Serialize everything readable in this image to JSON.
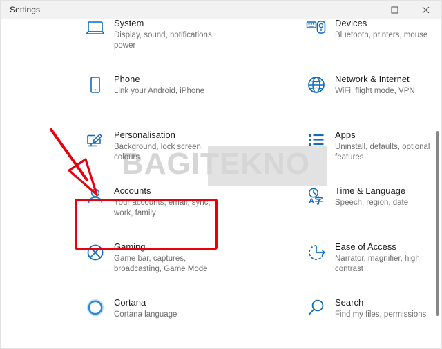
{
  "window": {
    "title": "Settings",
    "controls": [
      {
        "name": "minimize",
        "label": "–"
      },
      {
        "name": "maximize",
        "label": "□"
      },
      {
        "name": "close",
        "label": "×"
      }
    ]
  },
  "watermark": {
    "text": "BAGITEKNO"
  },
  "annotations": {
    "highlight_color": "#e8000d",
    "arrow_color": "#e8000d",
    "highlighted_tile": "Accounts"
  },
  "settings": {
    "tiles": [
      {
        "id": "system",
        "icon": "monitor-icon",
        "title": "System",
        "subtitle": "Display, sound, notifications, power"
      },
      {
        "id": "devices",
        "icon": "keyboard-mouse-icon",
        "title": "Devices",
        "subtitle": "Bluetooth, printers, mouse"
      },
      {
        "id": "phone",
        "icon": "phone-icon",
        "title": "Phone",
        "subtitle": "Link your Android, iPhone"
      },
      {
        "id": "network-internet",
        "icon": "globe-icon",
        "title": "Network & Internet",
        "subtitle": "WiFi, flight mode, VPN"
      },
      {
        "id": "personalisation",
        "icon": "brush-monitor-icon",
        "title": "Personalisation",
        "subtitle": "Background, lock screen, colours"
      },
      {
        "id": "apps",
        "icon": "list-icon",
        "title": "Apps",
        "subtitle": "Uninstall, defaults, optional features"
      },
      {
        "id": "accounts",
        "icon": "person-icon",
        "title": "Accounts",
        "subtitle": "Your accounts, email, sync, work, family"
      },
      {
        "id": "time-language",
        "icon": "clock-language-icon",
        "title": "Time & Language",
        "subtitle": "Speech, region, date"
      },
      {
        "id": "gaming",
        "icon": "xbox-icon",
        "title": "Gaming",
        "subtitle": "Game bar, captures, broadcasting, Game Mode"
      },
      {
        "id": "ease-of-access",
        "icon": "accessibility-clock-icon",
        "title": "Ease of Access",
        "subtitle": "Narrator, magnifier, high contrast"
      },
      {
        "id": "cortana",
        "icon": "cortana-ring-icon",
        "title": "Cortana",
        "subtitle": "Cortana language"
      },
      {
        "id": "search",
        "icon": "magnifier-icon",
        "title": "Search",
        "subtitle": "Find my files, permissions"
      }
    ]
  }
}
